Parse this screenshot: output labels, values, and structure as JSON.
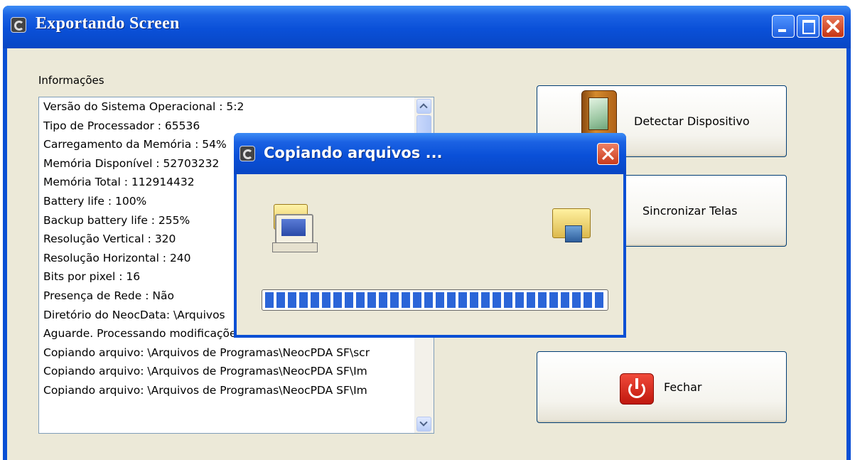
{
  "main_window": {
    "title": "Exportando Screen",
    "info": {
      "label": "Informações",
      "lines": [
        "Versão do Sistema Operacional : 5:2",
        "Tipo de Processador : 65536",
        "Carregamento da Memória : 54%",
        "Memória Disponível : 52703232",
        "Memória Total : 112914432",
        "Battery life : 100%",
        "Backup battery life : 255%",
        "Resolução Vertical : 320",
        "Resolução Horizontal : 240",
        "Bits por pixel : 16",
        "Presença de Rede : Não",
        "Diretório do NeocData: \\Arquivos",
        "Aguarde. Processando modificações.",
        "Copiando arquivo: \\Arquivos de Programas\\NeocPDA SF\\scr",
        "Copiando arquivo: \\Arquivos de Programas\\NeocPDA SF\\Im",
        "Copiando arquivo: \\Arquivos de Programas\\NeocPDA SF\\Im"
      ]
    },
    "buttons": {
      "detect": "Detectar Dispositivo",
      "sync": "Sincronizar Telas",
      "close": "Fechar"
    }
  },
  "copy_dialog": {
    "title": "Copiando arquivos ...",
    "progress_percent": 100
  },
  "icons": {
    "app": "app-icon",
    "device": "pda-device-icon",
    "power": "power-icon",
    "source": "computer-folder-icon",
    "target": "device-folder-icon"
  }
}
